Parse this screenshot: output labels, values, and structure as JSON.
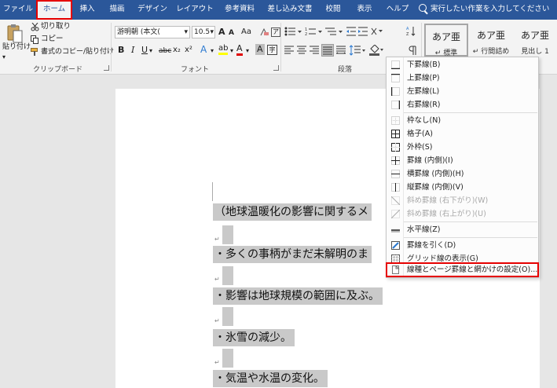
{
  "tabs": [
    {
      "label": "ファイル",
      "active": false
    },
    {
      "label": "ホーム",
      "active": true
    },
    {
      "label": "挿入",
      "active": false
    },
    {
      "label": "描画",
      "active": false
    },
    {
      "label": "デザイン",
      "active": false
    },
    {
      "label": "レイアウト",
      "active": false
    },
    {
      "label": "参考資料",
      "active": false
    },
    {
      "label": "差し込み文書",
      "active": false
    },
    {
      "label": "校閲",
      "active": false
    },
    {
      "label": "表示",
      "active": false
    },
    {
      "label": "ヘルプ",
      "active": false
    }
  ],
  "tell_me": "実行したい作業を入力してください",
  "clipboard": {
    "paste": "貼り付け",
    "cut": "切り取り",
    "copy": "コピー",
    "format_painter": "書式のコピー/貼り付け",
    "group_label": "クリップボード"
  },
  "font": {
    "font_name": "游明朝 (本文(",
    "font_size": "10.5",
    "grow": "A",
    "shrink": "A",
    "case": "Aa",
    "bold": "B",
    "italic": "I",
    "underline": "U",
    "strike": "abc",
    "subscript": "x₂",
    "superscript": "x²",
    "effects": "A",
    "highlight": "ab",
    "font_color": "A",
    "char_shading": "A",
    "group_label": "フォント"
  },
  "paragraph": {
    "group_label": "段落"
  },
  "styles": [
    {
      "sample": "あア亜",
      "name": "↵ 標準"
    },
    {
      "sample": "あア亜",
      "name": "↵ 行間詰め"
    },
    {
      "sample": "あア亜",
      "name": "見出し 1"
    }
  ],
  "colors": {
    "brand": "#2b579a",
    "highlight_box": "#e60000",
    "selection": "#c9c9c9",
    "highlight_yellow": "#ffff00",
    "font_red": "#e00000"
  },
  "menu": {
    "items": [
      {
        "label": "下罫線(B)",
        "icon": "border-bottom-icon",
        "disabled": false
      },
      {
        "label": "上罫線(P)",
        "icon": "border-top-icon",
        "disabled": false
      },
      {
        "label": "左罫線(L)",
        "icon": "border-left-icon",
        "disabled": false
      },
      {
        "label": "右罫線(R)",
        "icon": "border-right-icon",
        "disabled": false
      },
      {
        "sep": true
      },
      {
        "label": "枠なし(N)",
        "icon": "no-border-icon",
        "disabled": false
      },
      {
        "label": "格子(A)",
        "icon": "all-borders-icon",
        "disabled": false
      },
      {
        "label": "外枠(S)",
        "icon": "outside-borders-icon",
        "disabled": false
      },
      {
        "label": "罫線 (内側)(I)",
        "icon": "inside-borders-icon",
        "disabled": false
      },
      {
        "label": "横罫線 (内側)(H)",
        "icon": "inside-horizontal-border-icon",
        "disabled": false
      },
      {
        "label": "縦罫線 (内側)(V)",
        "icon": "inside-vertical-border-icon",
        "disabled": false
      },
      {
        "label": "斜め罫線 (右下がり)(W)",
        "icon": "diagonal-down-border-icon",
        "disabled": true
      },
      {
        "label": "斜め罫線 (右上がり)(U)",
        "icon": "diagonal-up-border-icon",
        "disabled": true
      },
      {
        "sep": true
      },
      {
        "label": "水平線(Z)",
        "icon": "horizontal-line-icon",
        "disabled": false
      },
      {
        "sep": true
      },
      {
        "label": "罫線を引く(D)",
        "icon": "draw-table-icon",
        "disabled": false
      },
      {
        "label": "グリッド線の表示(G)",
        "icon": "view-gridlines-icon",
        "disabled": false
      },
      {
        "label": "線種とページ罫線と網かけの設定(O)...",
        "icon": "borders-shading-icon",
        "disabled": false,
        "boxed": true
      }
    ]
  },
  "document": {
    "lines": [
      "（地球温暖化の影響に関するメ",
      "・多くの事柄がまだ未解明のま",
      "・影響は地球規模の範囲に及ぶ。",
      "・氷雪の減少。",
      "・気温や水温の変化。"
    ],
    "para_mark": "↵"
  }
}
